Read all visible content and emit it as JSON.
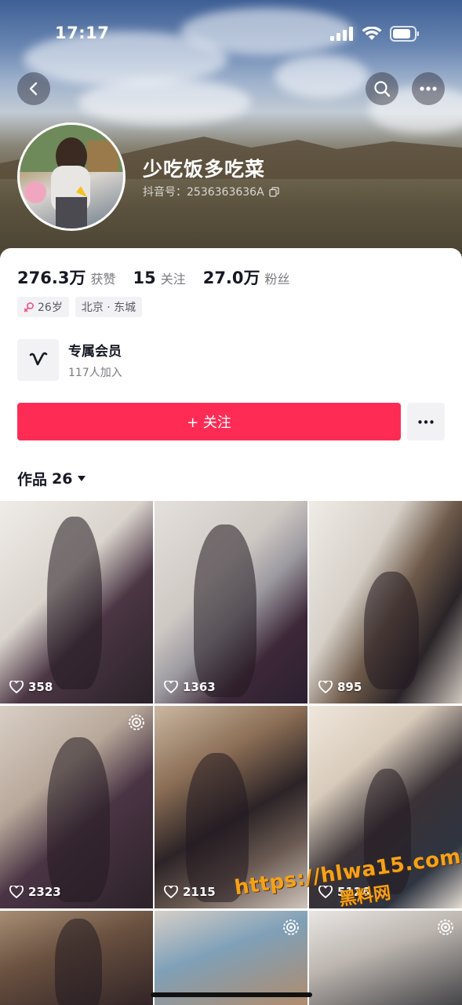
{
  "status_bar": {
    "time": "17:17"
  },
  "profile": {
    "nickname": "少吃饭多吃菜",
    "douyin_id": "抖音号：2536363636A"
  },
  "stats": [
    {
      "value": "276.3万",
      "label": "获赞"
    },
    {
      "value": "15",
      "label": "关注"
    },
    {
      "value": "27.0万",
      "label": "粉丝"
    }
  ],
  "tags": {
    "age": "26岁",
    "location": "北京 · 东城"
  },
  "member": {
    "title": "专属会员",
    "subtitle": "117人加入"
  },
  "actions": {
    "follow_label": "+ 关注"
  },
  "works": {
    "label": "作品",
    "count": "26"
  },
  "grid": [
    {
      "likes": "358",
      "pinned": false
    },
    {
      "likes": "1363",
      "pinned": false
    },
    {
      "likes": "895",
      "pinned": false
    },
    {
      "likes": "2323",
      "pinned": true
    },
    {
      "likes": "2115",
      "pinned": false
    },
    {
      "likes": "5126",
      "pinned": false
    },
    {
      "likes": "",
      "pinned": false
    },
    {
      "likes": "",
      "pinned": true
    },
    {
      "likes": "",
      "pinned": true
    }
  ],
  "watermark": {
    "url": "https://hlwa15.com",
    "name": "黑料网"
  },
  "colors": {
    "accent": "#fe2c55",
    "tag_bg": "#f2f2f4",
    "watermark": "#f4a21a"
  },
  "icons": {
    "back": "chevron-left-icon",
    "search": "search-icon",
    "more": "ellipsis-icon",
    "copy": "copy-icon",
    "gender": "female-icon",
    "heart": "heart-icon",
    "member": "vip-v-icon",
    "dropdown": "caret-down-icon",
    "pinned": "spiral-icon"
  }
}
